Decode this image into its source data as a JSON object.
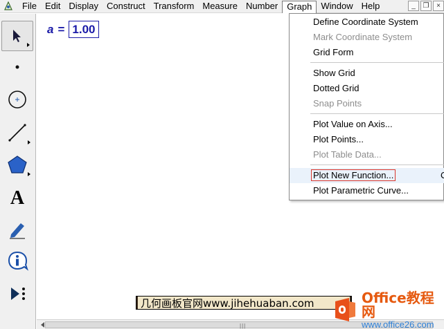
{
  "menubar": {
    "items": [
      "File",
      "Edit",
      "Display",
      "Construct",
      "Transform",
      "Measure",
      "Number",
      "Graph",
      "Window",
      "Help"
    ],
    "active": "Graph",
    "window_controls": [
      "_",
      "❐",
      "×"
    ]
  },
  "toolbox": {
    "tools": [
      "arrow-select-icon",
      "point-icon",
      "compass-icon",
      "straightedge-icon",
      "polygon-icon",
      "text-icon",
      "marker-icon",
      "information-icon",
      "custom-tool-icon"
    ],
    "selected": "arrow-select-icon"
  },
  "canvas": {
    "parameter": {
      "name": "a",
      "equals": "=",
      "value": "1.00"
    },
    "accent_color": "#1a1aa8"
  },
  "graph_menu": {
    "groups": [
      [
        {
          "label": "Define Coordinate System",
          "enabled": true
        },
        {
          "label": "Mark Coordinate System",
          "enabled": false
        },
        {
          "label": "Grid Form",
          "enabled": true
        }
      ],
      [
        {
          "label": "Show Grid",
          "enabled": true
        },
        {
          "label": "Dotted Grid",
          "enabled": true
        },
        {
          "label": "Snap Points",
          "enabled": false
        }
      ],
      [
        {
          "label": "Plot Value on Axis...",
          "enabled": true
        },
        {
          "label": "Plot Points...",
          "enabled": true
        },
        {
          "label": "Plot Table Data...",
          "enabled": false
        }
      ],
      [
        {
          "label": "Plot New Function...",
          "enabled": true,
          "highlighted": true,
          "shortcut": "C"
        },
        {
          "label": "Plot Parametric Curve...",
          "enabled": true
        }
      ]
    ]
  },
  "watermark": {
    "text": "几何画板官网www.jihehuaban.com",
    "logo_title": "Office教程网",
    "logo_url": "www.office26.com"
  }
}
